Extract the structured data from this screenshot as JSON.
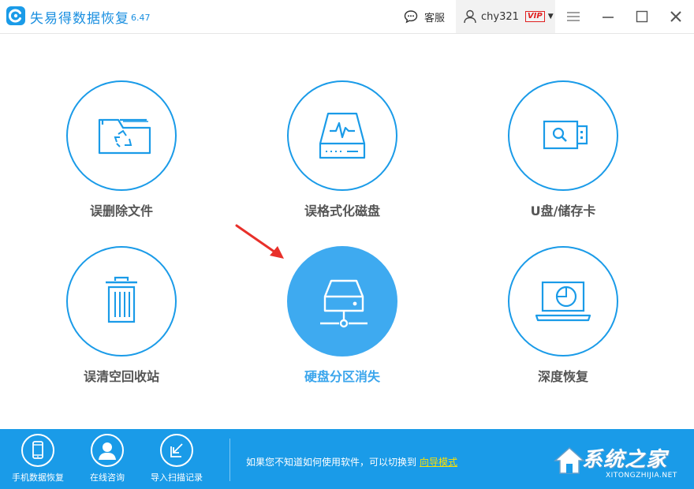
{
  "app": {
    "title": "失易得数据恢复",
    "version": "6.47"
  },
  "header": {
    "support_label": "客服",
    "username": "chy321",
    "vip_badge": "VIP"
  },
  "tiles": [
    {
      "label": "误删除文件",
      "icon": "folder-recycle-icon"
    },
    {
      "label": "误格式化磁盘",
      "icon": "disk-pulse-icon"
    },
    {
      "label": "U盘/储存卡",
      "icon": "usb-drive-icon"
    },
    {
      "label": "误清空回收站",
      "icon": "trash-icon"
    },
    {
      "label": "硬盘分区消失",
      "icon": "hard-drive-network-icon",
      "selected": true
    },
    {
      "label": "深度恢复",
      "icon": "laptop-scan-icon"
    }
  ],
  "footer": {
    "items": [
      {
        "label": "手机数据恢复",
        "icon": "phone-icon"
      },
      {
        "label": "在线咨询",
        "icon": "user-support-icon"
      },
      {
        "label": "导入扫描记录",
        "icon": "import-icon"
      }
    ],
    "hint_text": "如果您不知道如何使用软件，可以切换到",
    "hint_link": "向导模式",
    "watermark_main": "系统之家",
    "watermark_sub": "XITONGZHIJIA.NET"
  },
  "colors": {
    "accent": "#1a9be8",
    "active_circle": "#3eaaf0",
    "vip": "#e02020",
    "link": "#ffe100",
    "arrow": "#e8302a"
  }
}
